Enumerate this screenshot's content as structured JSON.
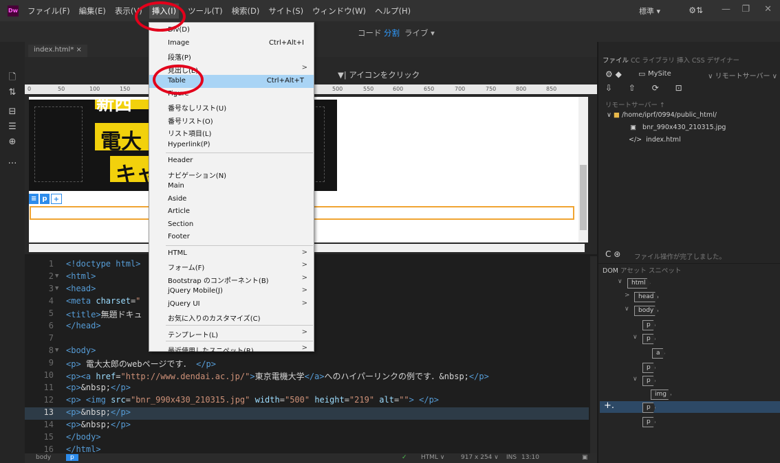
{
  "app": {
    "logo": "Dw"
  },
  "menubar": {
    "items": [
      "ファイル(F)",
      "編集(E)",
      "表示(V)",
      "挿入(I)",
      "ツール(T)",
      "検索(D)",
      "サイト(S)",
      "ウィンドウ(W)",
      "ヘルプ(H)"
    ],
    "workspace": "標準 ▾",
    "sync_icon": "gear-sync-icon"
  },
  "viewbar": {
    "code": "コード",
    "split": "分割",
    "live": "ライブ ▾"
  },
  "document": {
    "tab": "index.html* ×",
    "hint": "アイコンをクリック",
    "ruler": [
      "0",
      "50",
      "100",
      "150",
      "500",
      "550",
      "600",
      "650",
      "700",
      "750",
      "800",
      "850"
    ],
    "tag_bar": [
      "≡",
      "p",
      "+"
    ]
  },
  "banner": {
    "text1": "電大",
    "text2": "キャ",
    "text3": "新西"
  },
  "code": {
    "lines": [
      {
        "n": "1",
        "arrow": "",
        "html": "<span class=\"tg\">&lt;!doctype html&gt;</span>"
      },
      {
        "n": "2",
        "arrow": "▼",
        "html": "<span class=\"tg\">&lt;html&gt;</span>"
      },
      {
        "n": "3",
        "arrow": "▼",
        "html": "<span class=\"tg\">&lt;head&gt;</span>"
      },
      {
        "n": "4",
        "arrow": "",
        "html": "<span class=\"tg\">&lt;meta</span> <span class=\"at\">charset</span>=<span class=\"st\">\"</span>"
      },
      {
        "n": "5",
        "arrow": "",
        "html": "<span class=\"tg\">&lt;title&gt;</span>無題ドキュ"
      },
      {
        "n": "6",
        "arrow": "",
        "html": "<span class=\"tg\">&lt;/head&gt;</span>"
      },
      {
        "n": "7",
        "arrow": "",
        "html": ""
      },
      {
        "n": "8",
        "arrow": "▼",
        "html": "<span class=\"tg\">&lt;body&gt;</span>"
      },
      {
        "n": "9",
        "arrow": "",
        "html": "<span class=\"tg\">&lt;p&gt;</span> 電大太郎のwebページです． <span class=\"tg\">&lt;/p&gt;</span>"
      },
      {
        "n": "10",
        "arrow": "",
        "html": "<span class=\"tg\">&lt;p&gt;&lt;a</span> <span class=\"at\">href</span>=<span class=\"st\">\"http://www.dendai.ac.jp/\"</span><span class=\"tg\">&gt;</span>東京電機大学<span class=\"tg\">&lt;/a&gt;</span>へのハイパーリンクの例です．&amp;nbsp;<span class=\"tg\">&lt;/p&gt;</span>"
      },
      {
        "n": "11",
        "arrow": "",
        "html": "<span class=\"tg\">&lt;p&gt;</span>&amp;nbsp;<span class=\"tg\">&lt;/p&gt;</span>"
      },
      {
        "n": "12",
        "arrow": "",
        "html": "<span class=\"tg\">&lt;p&gt;</span> <span class=\"tg\">&lt;img</span> <span class=\"at\">src</span>=<span class=\"st\">\"bnr_990x430_210315.jpg\"</span> <span class=\"at\">width</span>=<span class=\"st\">\"500\"</span> <span class=\"at\">height</span>=<span class=\"st\">\"219\"</span> <span class=\"at\">alt</span>=<span class=\"st\">\"\"</span><span class=\"tg\">&gt;</span> <span class=\"tg\">&lt;/p&gt;</span>"
      },
      {
        "n": "13",
        "arrow": "",
        "html": "<span class=\"tg\">&lt;p&gt;</span>&amp;nbsp;<span class=\"tg\">&lt;/p&gt;</span>"
      },
      {
        "n": "14",
        "arrow": "",
        "html": "<span class=\"tg\">&lt;p&gt;</span>&amp;nbsp;<span class=\"tg\">&lt;/p&gt;</span>"
      },
      {
        "n": "15",
        "arrow": "",
        "html": "<span class=\"tg\">&lt;/body&gt;</span>"
      },
      {
        "n": "16",
        "arrow": "",
        "html": "<span class=\"tg\">&lt;/html&gt;</span>"
      }
    ]
  },
  "statusbar": {
    "tag1": "body",
    "tag2": "p",
    "lang": "HTML ∨",
    "size": "917 x 254 ∨",
    "mode": "INS",
    "pos": "13:10"
  },
  "files": {
    "tabs": [
      "ファイル",
      "CC ライブラリ",
      "挿入",
      "CSS デザイナー"
    ],
    "site": "MySite",
    "remote": "∨ リモートサーバー ∨",
    "icons": "⇩ ⇧ ⟳ ⊡",
    "remote_label": "リモートサーバー ↑",
    "root": "/home/iprf/0994/public_html/",
    "file1": "bnr_990x430_210315.jpg",
    "file2": "index.html",
    "status": "ファイル操作が完了しました。"
  },
  "dom": {
    "tabs": [
      "DOM",
      "アセット",
      "スニペット"
    ],
    "nodes": [
      "html",
      "head",
      "body",
      "p",
      "p",
      "a",
      "p",
      "p",
      "img",
      "p",
      "p"
    ]
  },
  "insert_menu": {
    "items": [
      {
        "label": "Div(D)",
        "shortcut": "",
        "sub": false
      },
      {
        "label": "Image",
        "shortcut": "Ctrl+Alt+I",
        "sub": false
      },
      {
        "label": "段落(P)",
        "shortcut": "",
        "sub": false
      },
      {
        "label": "見出し(E)",
        "shortcut": "",
        "sub": true
      },
      {
        "label": "Table",
        "shortcut": "Ctrl+Alt+T",
        "sub": false,
        "highlight": true
      },
      {
        "label": "Figure",
        "shortcut": "",
        "sub": false
      },
      {
        "label": "番号なしリスト(U)",
        "shortcut": "",
        "sub": false
      },
      {
        "label": "番号リスト(O)",
        "shortcut": "",
        "sub": false
      },
      {
        "label": "リスト項目(L)",
        "shortcut": "",
        "sub": false
      },
      {
        "label": "Hyperlink(P)",
        "shortcut": "",
        "sub": false
      },
      {
        "sep": true
      },
      {
        "label": "Header",
        "shortcut": "",
        "sub": false
      },
      {
        "label": "ナビゲーション(N)",
        "shortcut": "",
        "sub": false
      },
      {
        "label": "Main",
        "shortcut": "",
        "sub": false
      },
      {
        "label": "Aside",
        "shortcut": "",
        "sub": false
      },
      {
        "label": "Article",
        "shortcut": "",
        "sub": false
      },
      {
        "label": "Section",
        "shortcut": "",
        "sub": false
      },
      {
        "label": "Footer",
        "shortcut": "",
        "sub": false
      },
      {
        "sep": true
      },
      {
        "label": "HTML",
        "shortcut": "",
        "sub": true
      },
      {
        "label": "フォーム(F)",
        "shortcut": "",
        "sub": true
      },
      {
        "label": "Bootstrap のコンポーネント(B)",
        "shortcut": "",
        "sub": true
      },
      {
        "label": "jQuery Mobile(J)",
        "shortcut": "",
        "sub": true
      },
      {
        "label": "jQuery UI",
        "shortcut": "",
        "sub": true
      },
      {
        "label": "お気に入りのカスタマイズ(C)",
        "shortcut": "",
        "sub": false
      },
      {
        "sep": true
      },
      {
        "label": "テンプレート(L)",
        "shortcut": "",
        "sub": true
      },
      {
        "sep": true
      },
      {
        "label": "最近使用したスニペット(R)",
        "shortcut": "",
        "sub": true
      }
    ]
  },
  "colors": {
    "accent": "#2e9bff",
    "annotation": "#e3001b",
    "highlight": "#a9d4f5",
    "selection_border": "#f0a431"
  }
}
